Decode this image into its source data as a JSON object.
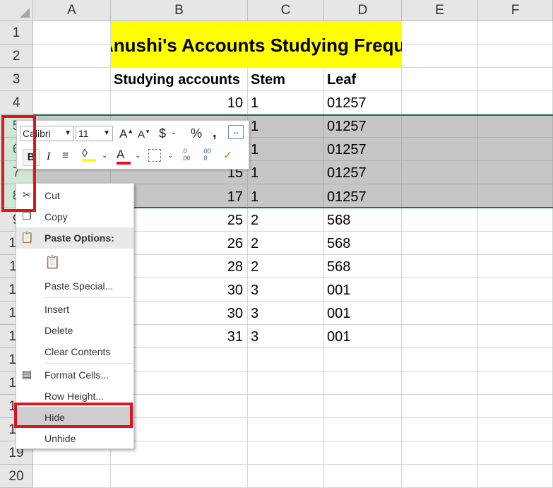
{
  "columns": [
    "A",
    "B",
    "C",
    "D",
    "E",
    "F"
  ],
  "rows": [
    "1",
    "2",
    "3",
    "4",
    "5",
    "6",
    "7",
    "8",
    "9",
    "10",
    "11",
    "12",
    "13",
    "14",
    "15",
    "16",
    "17",
    "18",
    "19",
    "20"
  ],
  "title": "Anushi's Accounts Studying Frequency",
  "headers": {
    "b": "Studying accounts",
    "c": "Stem",
    "d": "Leaf"
  },
  "data_rows": [
    {
      "b": "10",
      "c": "1",
      "d": "01257"
    },
    {
      "b": "",
      "c": "1",
      "d": "01257"
    },
    {
      "b": "",
      "c": "1",
      "d": "01257"
    },
    {
      "b": "15",
      "c": "1",
      "d": "01257"
    },
    {
      "b": "17",
      "c": "1",
      "d": "01257"
    },
    {
      "b": "25",
      "c": "2",
      "d": "568"
    },
    {
      "b": "26",
      "c": "2",
      "d": "568"
    },
    {
      "b": "28",
      "c": "2",
      "d": "568"
    },
    {
      "b": "30",
      "c": "3",
      "d": "001"
    },
    {
      "b": "30",
      "c": "3",
      "d": "001"
    },
    {
      "b": "31",
      "c": "3",
      "d": "001"
    }
  ],
  "mini_toolbar": {
    "font": "Calibri",
    "size": "11",
    "currency": "$",
    "percent": "%",
    "comma": ",",
    "bold": "B",
    "italic": "I",
    "font_color_letter": "A",
    "increase_decimal": ".0 .00",
    "decrease_decimal": ".00 .0"
  },
  "context_menu": {
    "cut": "Cut",
    "copy": "Copy",
    "paste_options": "Paste Options:",
    "paste_special": "Paste Special...",
    "insert": "Insert",
    "delete": "Delete",
    "clear_contents": "Clear Contents",
    "format_cells": "Format Cells...",
    "row_height": "Row Height...",
    "hide": "Hide",
    "unhide": "Unhide"
  },
  "colors": {
    "accent": "#217346",
    "highlight": "#ffff00",
    "annotation": "#e0141e"
  }
}
